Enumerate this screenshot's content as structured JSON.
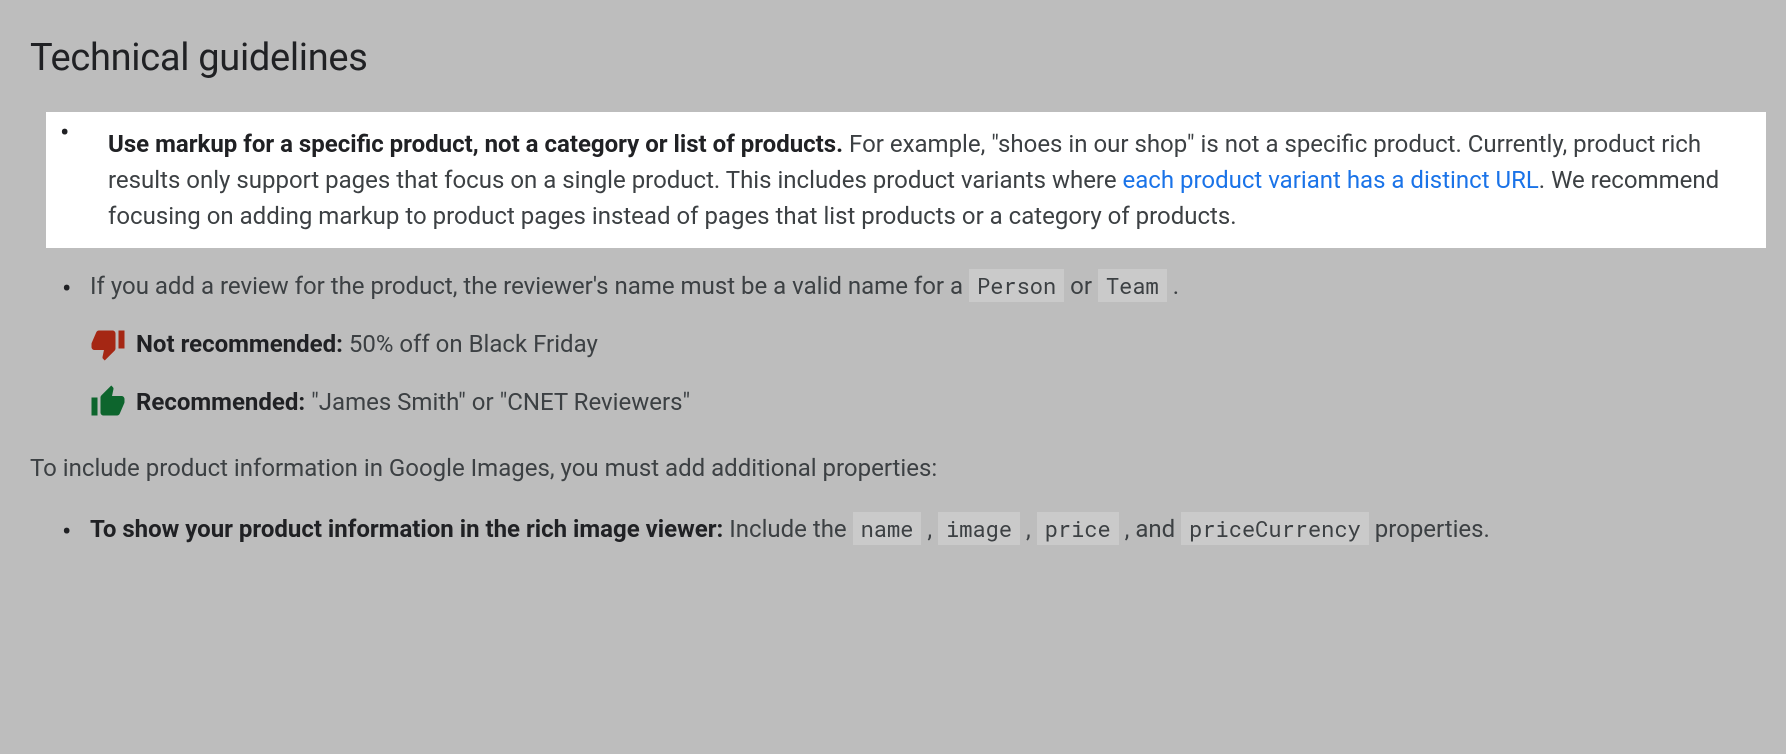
{
  "heading": "Technical guidelines",
  "bullet1": {
    "bold": "Use markup for a specific product, not a category or list of products.",
    "text_before_link": " For example, \"shoes in our shop\" is not a specific product. Currently, product rich results only support pages that focus on a single product. This includes product variants where ",
    "link": "each product variant has a distinct URL",
    "text_after_link": ". We recommend focusing on adding markup to product pages instead of pages that list products or a category of products."
  },
  "bullet2": {
    "text_before_code1": "If you add a review for the product, the reviewer's name must be a valid name for a ",
    "code1": "Person",
    "mid": " or ",
    "code2": "Team",
    "end": " .",
    "not_rec_label": "Not recommended:",
    "not_rec_text": " 50% off on Black Friday",
    "rec_label": "Recommended:",
    "rec_text": " \"James Smith\" or \"CNET Reviewers\""
  },
  "intro": "To include product information in Google Images, you must add additional properties:",
  "bullet3": {
    "bold": "To show your product information in the rich image viewer:",
    "text1": " Include the ",
    "code1": "name",
    "sep1": " , ",
    "code2": "image",
    "sep2": " , ",
    "code3": "price",
    "sep3": " , and ",
    "code4": "priceCurrency",
    "text_end": " properties."
  }
}
